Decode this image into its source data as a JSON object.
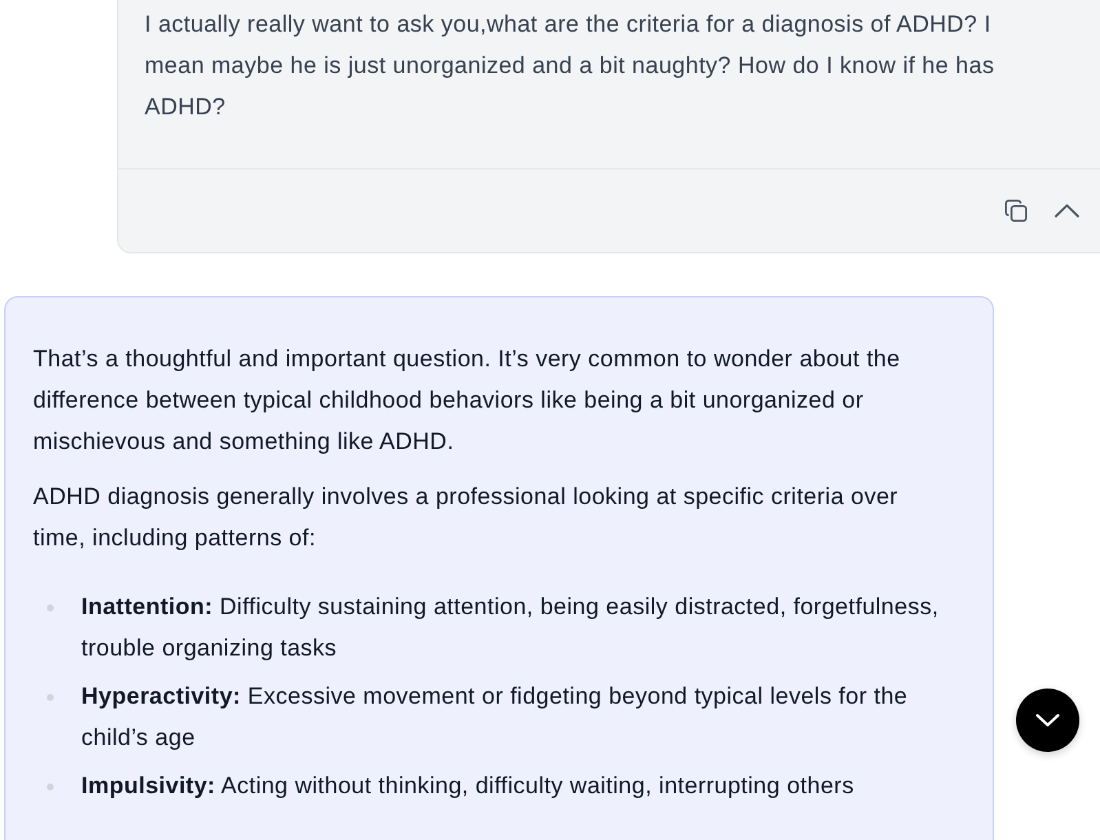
{
  "user_message": {
    "text": "I actually really want to ask you,what are the criteria for a diagnosis of ADHD? I mean maybe he is just unorganized and a bit naughty? How do I know if he has ADHD?"
  },
  "assistant_message": {
    "paragraphs": [
      "That’s a thoughtful and important question. It’s very common to wonder about the difference between typical childhood behaviors like being a bit unorganized or mischievous and something like ADHD.",
      "ADHD diagnosis generally involves a professional looking at specific criteria over time, including patterns of:"
    ],
    "list": [
      "**Inattention:** Difficulty sustaining attention, being easily distracted, forgetfulness, trouble organizing tasks",
      "**Hyperactivity:** Excessive movement or fidgeting beyond typical levels for the child’s age",
      "**Impulsivity:** Acting without thinking, difficulty waiting, interrupting others"
    ]
  }
}
